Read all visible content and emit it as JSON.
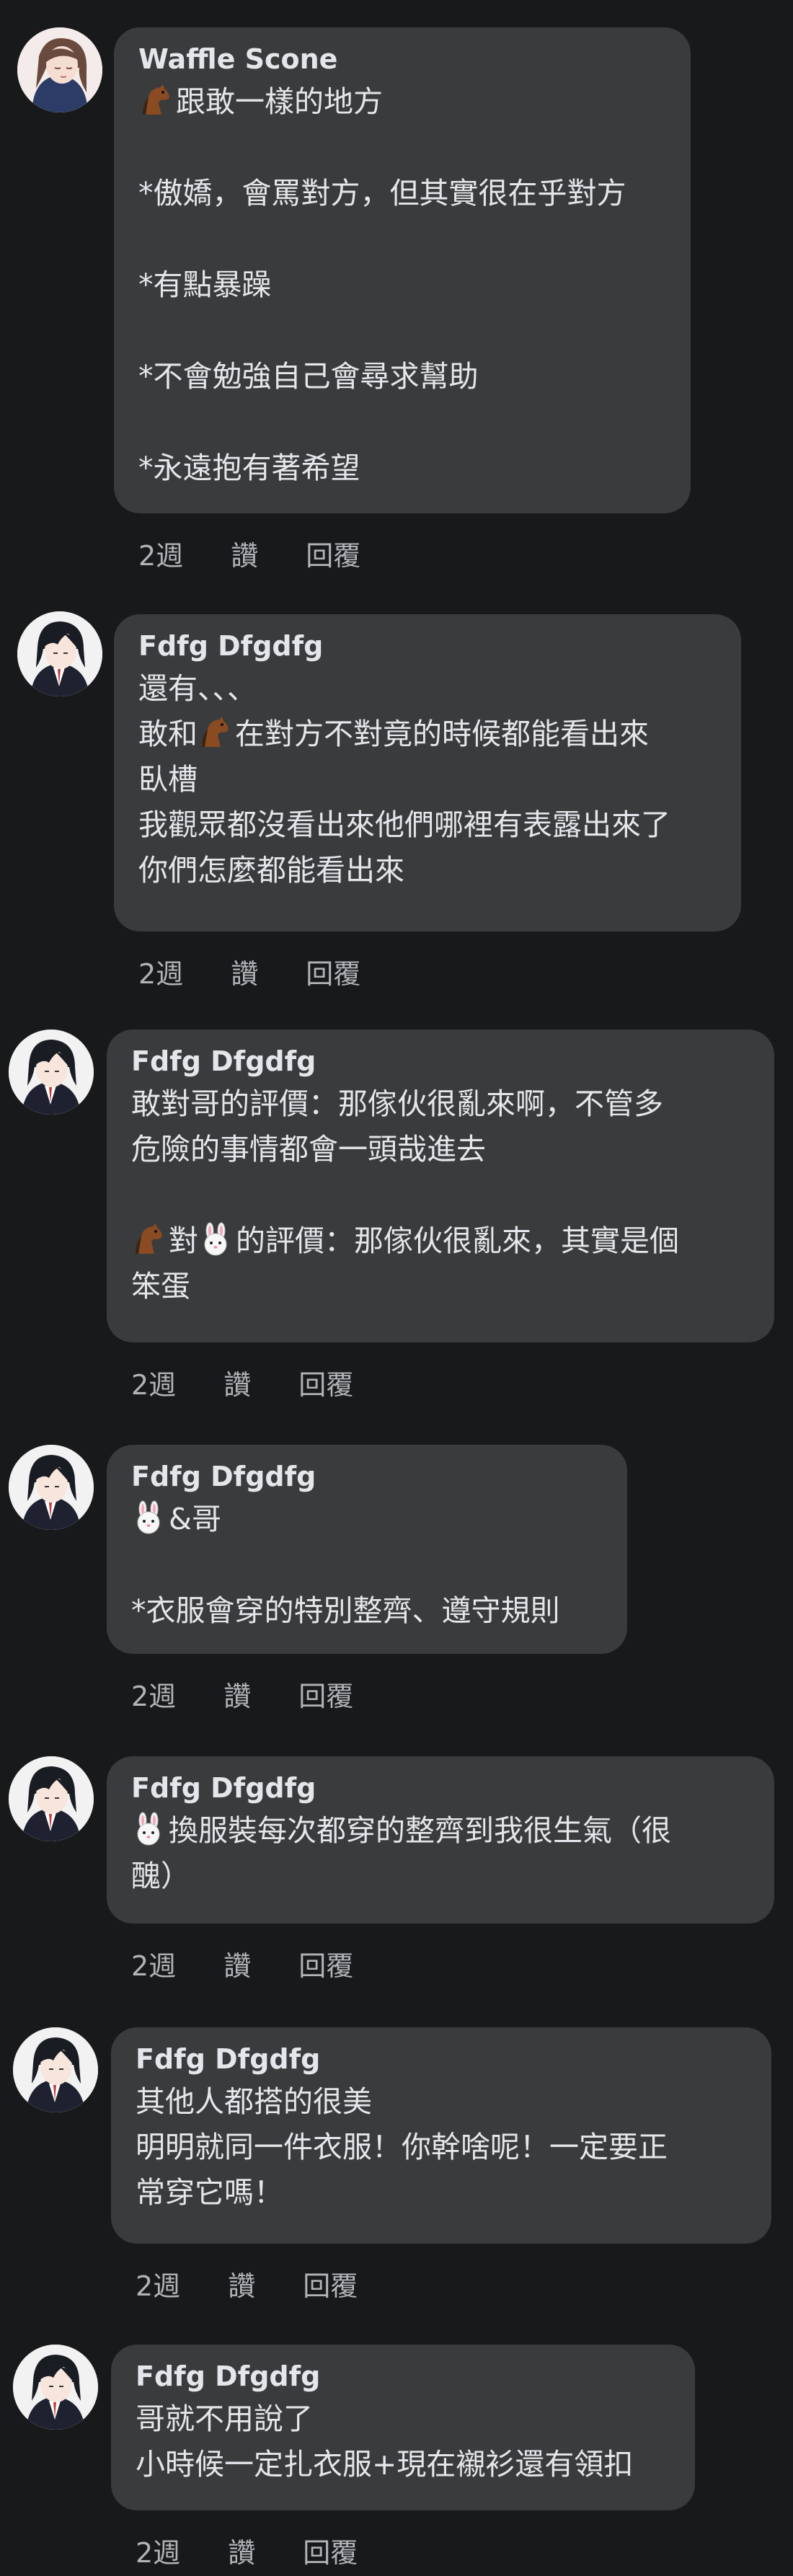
{
  "comments": [
    {
      "author": "Waffle Scone",
      "avatar": "avatar-girl",
      "lines": [
        {
          "emoji": "horse-icon",
          "text": "跟敢一樣的地方"
        },
        {
          "gap": true
        },
        {
          "text": "*傲嬌，會罵對方，但其實很在乎對方"
        },
        {
          "gap": true
        },
        {
          "text": "*有點暴躁"
        },
        {
          "gap": true
        },
        {
          "text": "*不會勉強自己會尋求幫助"
        },
        {
          "gap": true
        },
        {
          "text": "*永遠抱有著希望"
        }
      ],
      "time": "2週",
      "like": "讚",
      "reply": "回覆"
    },
    {
      "author": "Fdfg Dfgdfg",
      "avatar": "avatar-boy",
      "lines": [
        {
          "text": "還有、、、"
        },
        {
          "text": "敢和",
          "emoji_after": "horse-icon",
          "text2": "在對方不對竟的時候都能看出來"
        },
        {
          "text": "臥槽"
        },
        {
          "text": "我觀眾都沒看出來他們哪裡有表露出來了"
        },
        {
          "text": "你們怎麼都能看出來"
        }
      ],
      "time": "2週",
      "like": "讚",
      "reply": "回覆"
    },
    {
      "author": "Fdfg Dfgdfg",
      "avatar": "avatar-boy",
      "lines": [
        {
          "text": "敢對哥的評價：那傢伙很亂來啊，不管多"
        },
        {
          "text": "危險的事情都會一頭哉進去"
        },
        {
          "gap": true
        },
        {
          "emoji": "horse-icon",
          "text": "對",
          "emoji_after": "rabbit-icon",
          "text2": "的評價：那傢伙很亂來，其實是個"
        },
        {
          "text": "笨蛋"
        }
      ],
      "time": "2週",
      "like": "讚",
      "reply": "回覆"
    },
    {
      "author": "Fdfg Dfgdfg",
      "avatar": "avatar-boy",
      "lines": [
        {
          "emoji": "rabbit-icon",
          "text": "&哥"
        },
        {
          "gap": true
        },
        {
          "text": "*衣服會穿的特別整齊、遵守規則"
        }
      ],
      "time": "2週",
      "like": "讚",
      "reply": "回覆"
    },
    {
      "author": "Fdfg Dfgdfg",
      "avatar": "avatar-boy",
      "lines": [
        {
          "emoji": "rabbit-icon",
          "text": "換服裝每次都穿的整齊到我很生氣（很"
        },
        {
          "text": "醜）"
        }
      ],
      "time": "2週",
      "like": "讚",
      "reply": "回覆"
    },
    {
      "author": "Fdfg Dfgdfg",
      "avatar": "avatar-boy",
      "lines": [
        {
          "text": "其他人都搭的很美"
        },
        {
          "text": "明明就同一件衣服！你幹啥呢！一定要正"
        },
        {
          "text": "常穿它嗎！"
        }
      ],
      "time": "2週",
      "like": "讚",
      "reply": "回覆"
    },
    {
      "author": "Fdfg Dfgdfg",
      "avatar": "avatar-boy",
      "lines": [
        {
          "text": "哥就不用說了"
        },
        {
          "text": "小時候一定扎衣服+現在襯衫還有領扣"
        }
      ],
      "time": "2週",
      "like": "讚",
      "reply": "回覆"
    }
  ]
}
